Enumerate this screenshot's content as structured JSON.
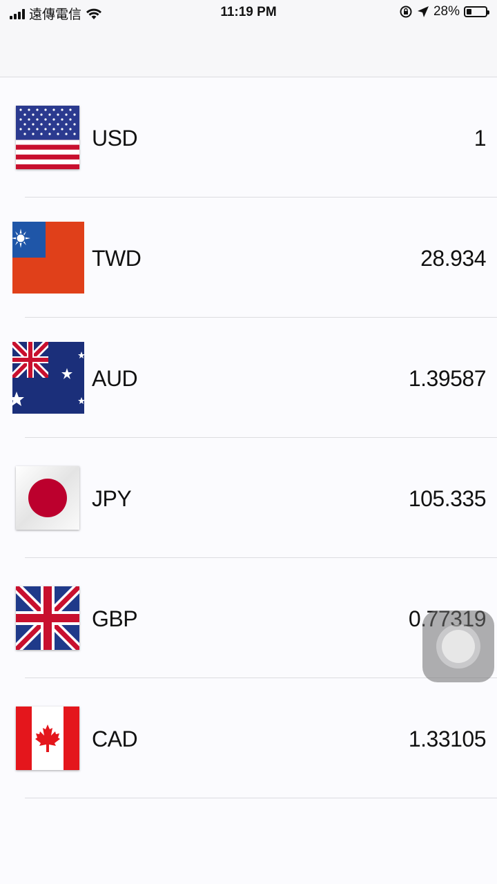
{
  "status_bar": {
    "carrier": "遠傳電信",
    "time": "11:19 PM",
    "battery_text": "28%",
    "battery_level": 0.28,
    "icons": [
      "signal-icon",
      "wifi-icon",
      "orientation-lock-icon",
      "location-icon",
      "battery-icon"
    ]
  },
  "currencies": [
    {
      "code": "USD",
      "value": "1",
      "flag": "us-flag-icon"
    },
    {
      "code": "TWD",
      "value": "28.934",
      "flag": "taiwan-flag-icon"
    },
    {
      "code": "AUD",
      "value": "1.39587",
      "flag": "australia-flag-icon"
    },
    {
      "code": "JPY",
      "value": "105.335",
      "flag": "japan-flag-icon"
    },
    {
      "code": "GBP",
      "value": "0.77319",
      "flag": "uk-flag-icon"
    },
    {
      "code": "CAD",
      "value": "1.33105",
      "flag": "canada-flag-icon"
    }
  ],
  "colors": {
    "background": "#fbfbfe",
    "separator": "#dcdce0",
    "text": "#111111"
  }
}
